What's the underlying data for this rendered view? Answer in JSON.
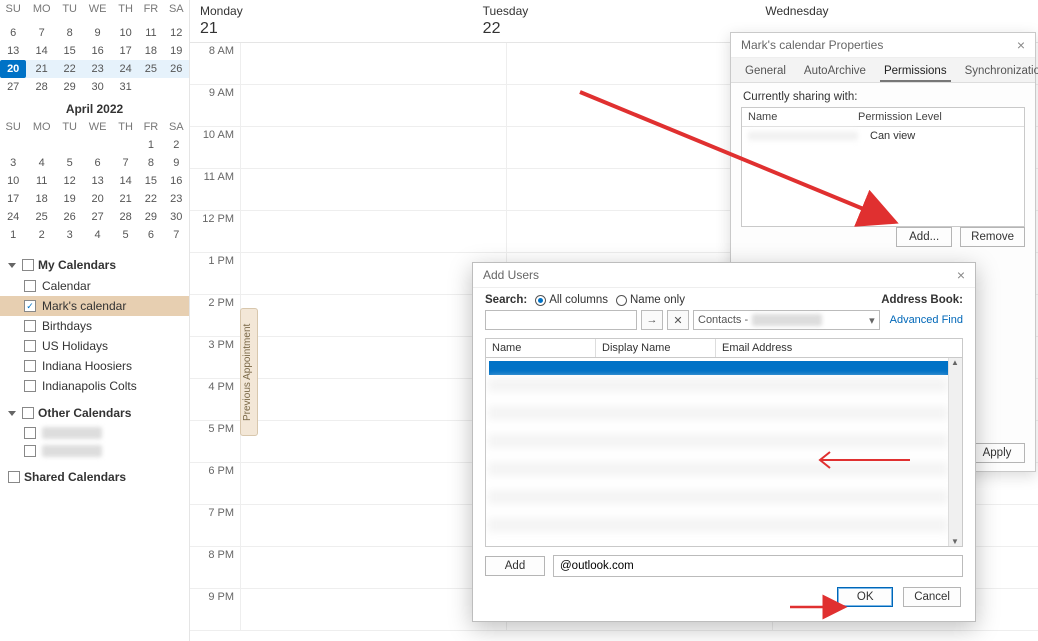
{
  "calendar": {
    "days": [
      {
        "dow": "Monday",
        "num": "21"
      },
      {
        "dow": "Tuesday",
        "num": "22"
      },
      {
        "dow": "Wednesday",
        "num": ""
      }
    ],
    "time_labels": [
      "8 AM",
      "9 AM",
      "10 AM",
      "11 AM",
      "12 PM",
      "1 PM",
      "2 PM",
      "3 PM",
      "4 PM",
      "5 PM",
      "6 PM",
      "7 PM",
      "8 PM",
      "9 PM"
    ],
    "prev_appt": "Previous Appointment"
  },
  "minical": {
    "month1_title": "",
    "month2_title": "April 2022",
    "weekday_hdr": [
      "SU",
      "MO",
      "TU",
      "WE",
      "TH",
      "FR",
      "SA"
    ],
    "month1_rows": [
      [
        "",
        "",
        "",
        "",
        "",
        "",
        ""
      ],
      [
        "6",
        "7",
        "8",
        "9",
        "10",
        "11",
        "12"
      ],
      [
        "13",
        "14",
        "15",
        "16",
        "17",
        "18",
        "19"
      ],
      [
        "20",
        "21",
        "22",
        "23",
        "24",
        "25",
        "26"
      ],
      [
        "27",
        "28",
        "29",
        "30",
        "31",
        "",
        ""
      ]
    ],
    "month1_today": "20",
    "month1_hl_row": 3,
    "month2_rows": [
      [
        "",
        "",
        "",
        "",
        "",
        "1",
        "2"
      ],
      [
        "3",
        "4",
        "5",
        "6",
        "7",
        "8",
        "9"
      ],
      [
        "10",
        "11",
        "12",
        "13",
        "14",
        "15",
        "16"
      ],
      [
        "17",
        "18",
        "19",
        "20",
        "21",
        "22",
        "23"
      ],
      [
        "24",
        "25",
        "26",
        "27",
        "28",
        "29",
        "30"
      ],
      [
        "1",
        "2",
        "3",
        "4",
        "5",
        "6",
        "7"
      ]
    ]
  },
  "sidebar": {
    "group_my": "My Calendars",
    "group_other": "Other Calendars",
    "group_shared": "Shared Calendars",
    "items_my": [
      "Calendar",
      "Mark's calendar",
      "Birthdays",
      "US Holidays",
      "Indiana Hoosiers",
      "Indianapolis Colts"
    ],
    "selected_index": 1,
    "checked_index": 1
  },
  "props": {
    "title": "Mark's calendar Properties",
    "tabs": [
      "General",
      "AutoArchive",
      "Permissions",
      "Synchronization"
    ],
    "active_tab": 2,
    "sharing_label": "Currently sharing with:",
    "col_name": "Name",
    "col_perm": "Permission Level",
    "row_perm": "Can view",
    "permissions_label": "Permissions",
    "add_btn": "Add...",
    "remove_btn": "Remove",
    "apply_btn": "Apply"
  },
  "addusers": {
    "title": "Add Users",
    "search_label": "Search:",
    "radio_all": "All columns",
    "radio_name": "Name only",
    "book_label": "Address Book:",
    "book_value": "Contacts -",
    "go_icon": "→",
    "clear_icon": "✕",
    "adv_link": "Advanced Find",
    "col_name": "Name",
    "col_display": "Display Name",
    "col_email": "Email Address",
    "add_btn": "Add",
    "addr_value": "@outlook.com",
    "ok_btn": "OK",
    "cancel_btn": "Cancel"
  }
}
